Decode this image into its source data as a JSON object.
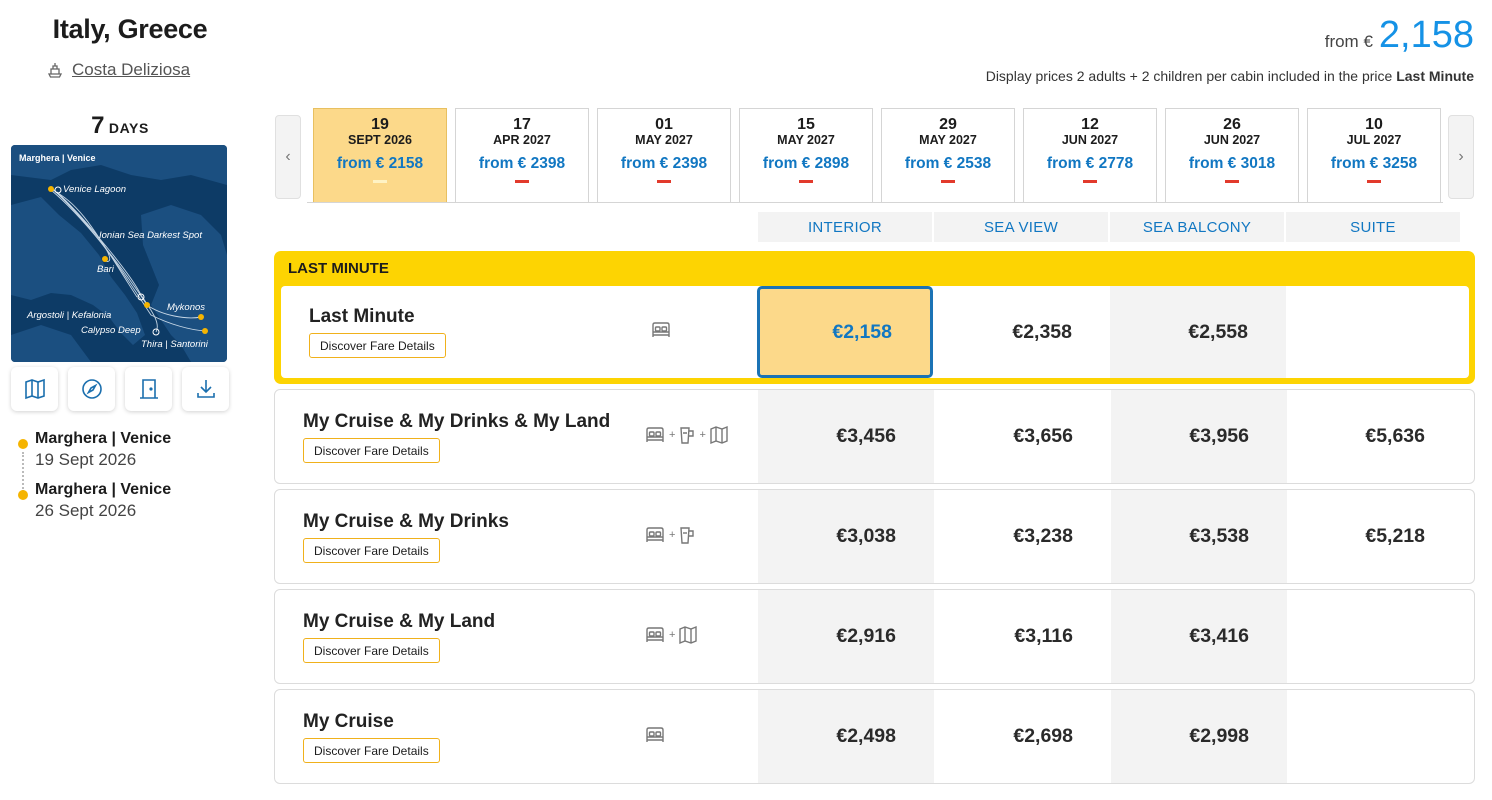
{
  "destination": {
    "title": "Italy, Greece",
    "ship_name": "Costa Deliziosa"
  },
  "duration": {
    "number": "7",
    "unit": "DAYS"
  },
  "map": {
    "header": "Marghera | Venice",
    "labels": [
      "Venice Lagoon",
      "Ionian Sea Darkest Spot",
      "Bari",
      "Mykonos",
      "Argostoli | Kefalonia",
      "Calypso Deep",
      "Thira | Santorini"
    ]
  },
  "map_actions": [
    "map-icon",
    "compass-icon",
    "door-icon",
    "download-icon"
  ],
  "itinerary": [
    {
      "port": "Marghera | Venice",
      "date": "19 Sept 2026"
    },
    {
      "port": "Marghera | Venice",
      "date": "26 Sept 2026"
    }
  ],
  "header": {
    "from_label": "from €",
    "price": "2,158",
    "note": "Display prices 2 adults + 2 children per cabin included in the price",
    "note_bold": "Last Minute"
  },
  "dates": [
    {
      "day": "19",
      "month": "SEPT 2026",
      "price": "from € 2158",
      "active": true
    },
    {
      "day": "17",
      "month": "APR 2027",
      "price": "from € 2398"
    },
    {
      "day": "01",
      "month": "MAY 2027",
      "price": "from € 2398"
    },
    {
      "day": "15",
      "month": "MAY 2027",
      "price": "from € 2898"
    },
    {
      "day": "29",
      "month": "MAY 2027",
      "price": "from € 2538"
    },
    {
      "day": "12",
      "month": "JUN 2027",
      "price": "from € 2778"
    },
    {
      "day": "26",
      "month": "JUN 2027",
      "price": "from € 3018"
    },
    {
      "day": "10",
      "month": "JUL 2027",
      "price": "from € 3258"
    }
  ],
  "cabins": [
    "INTERIOR",
    "SEA VIEW",
    "SEA BALCONY",
    "SUITE"
  ],
  "last_minute_tag": "LAST MINUTE",
  "details_label": "Discover Fare Details",
  "fares": [
    {
      "name": "Last Minute",
      "icons": [
        "bed-icon"
      ],
      "prices": [
        "€2,158",
        "€2,358",
        "€2,558",
        ""
      ]
    },
    {
      "name": "My Cruise & My Drinks & My Land",
      "icons": [
        "bed-icon",
        "drinks-icon",
        "map-icon"
      ],
      "prices": [
        "€3,456",
        "€3,656",
        "€3,956",
        "€5,636"
      ]
    },
    {
      "name": "My Cruise & My Drinks",
      "icons": [
        "bed-icon",
        "drinks-icon"
      ],
      "prices": [
        "€3,038",
        "€3,238",
        "€3,538",
        "€5,218"
      ]
    },
    {
      "name": "My Cruise & My Land",
      "icons": [
        "bed-icon",
        "map-icon"
      ],
      "prices": [
        "€2,916",
        "€3,116",
        "€3,416",
        ""
      ]
    },
    {
      "name": "My Cruise",
      "icons": [
        "bed-icon"
      ],
      "prices": [
        "€2,498",
        "€2,698",
        "€2,998",
        ""
      ]
    }
  ],
  "colors": {
    "accent_blue": "#1592e6",
    "price_blue": "#1177c2",
    "yellow": "#fdd402",
    "active_date": "#fcd98a",
    "red_bar": "#e23a2c"
  }
}
